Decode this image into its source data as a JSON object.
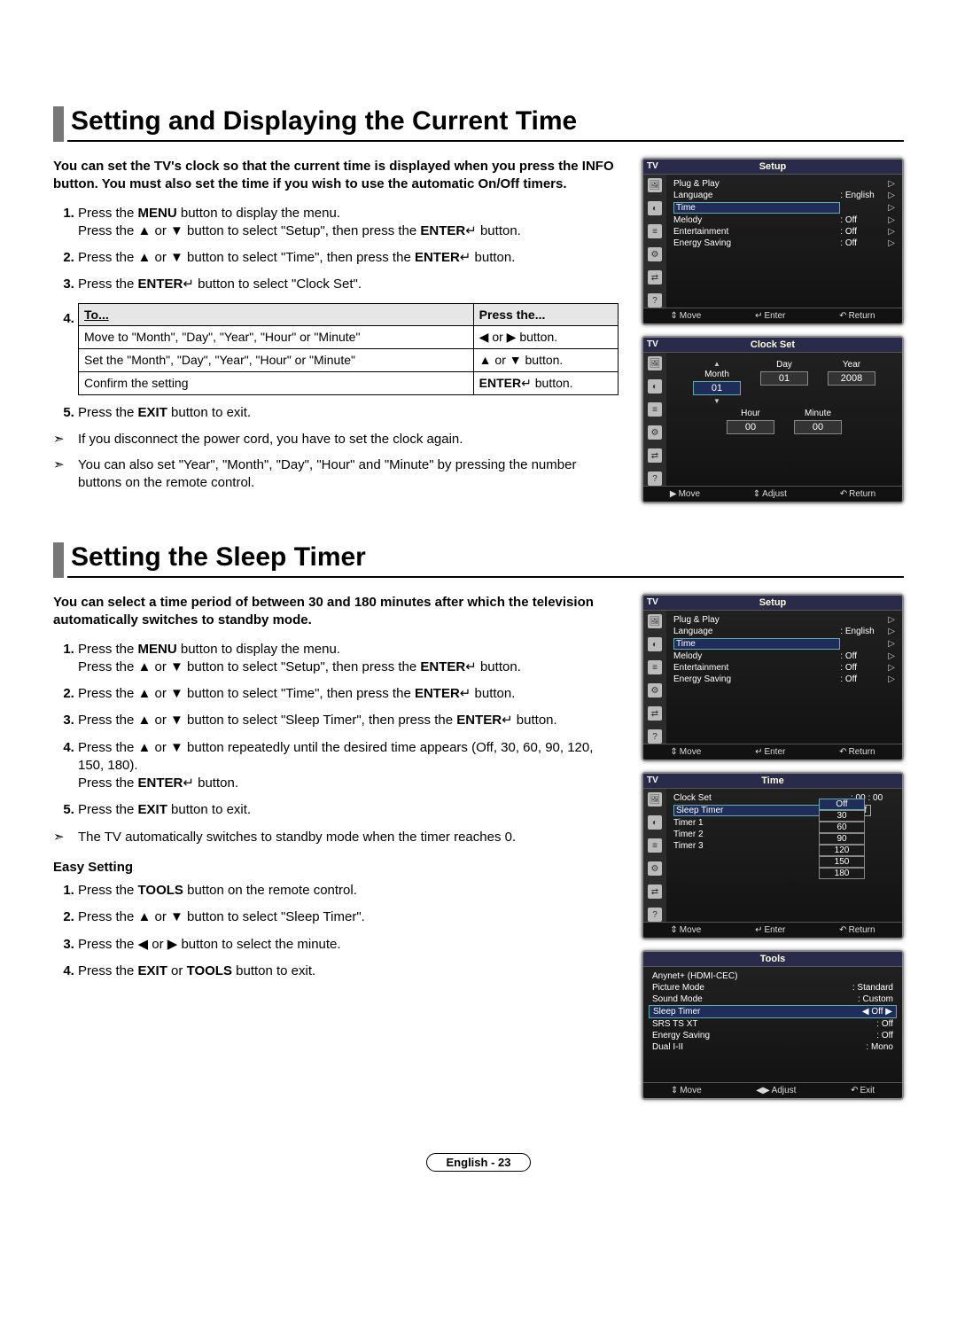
{
  "section1": {
    "heading": "Setting and Displaying the Current Time",
    "intro": "You can set the TV's clock so that the current time is displayed when you press the INFO button. You must also set the time if you wish to use the automatic On/Off timers.",
    "steps": {
      "1": {
        "a": "Press the ",
        "menu": "MENU",
        "b": " button to display the menu.",
        "c": "Press the ▲ or ▼ button to select \"Setup\", then press the ",
        "enter": "ENTER",
        "d": " button."
      },
      "2": {
        "a": "Press the ▲ or ▼ button to select \"Time\", then press the ",
        "enter": "ENTER",
        "b": " button."
      },
      "3": {
        "a": "Press the ",
        "enter": "ENTER",
        "b": " button to select \"Clock Set\"."
      },
      "4num": "4.",
      "5": {
        "a": "Press the ",
        "exit": "EXIT",
        "b": " button to exit."
      }
    },
    "table": {
      "h1": "To...",
      "h2": "Press the...",
      "r1c1": "Move to \"Month\", \"Day\", \"Year\", \"Hour\" or \"Minute\"",
      "r1c2": "◀ or ▶ button.",
      "r2c1": "Set the \"Month\", \"Day\", \"Year\", \"Hour\" or \"Minute\"",
      "r2c2": "▲ or ▼ button.",
      "r3c1": "Confirm the setting",
      "r3c2a": "ENTER",
      "r3c2b": " button."
    },
    "notes": {
      "n1": "If you disconnect the power cord, you have to set the clock again.",
      "n2": "You can also set \"Year\", \"Month\", \"Day\", \"Hour\" and \"Minute\" by pressing the number buttons on the remote control."
    }
  },
  "section2": {
    "heading": "Setting the Sleep Timer",
    "intro": "You can select a time period of between 30 and 180 minutes after which the television automatically switches to standby mode.",
    "steps": {
      "1": {
        "a": "Press the ",
        "menu": "MENU",
        "b": " button to display the menu.",
        "c": "Press the ▲ or ▼ button to select \"Setup\", then press the ",
        "enter": "ENTER",
        "d": " button."
      },
      "2": {
        "a": "Press the ▲ or ▼ button to select \"Time\", then press the ",
        "enter": "ENTER",
        "b": " button."
      },
      "3": {
        "a": "Press the ▲ or ▼ button to select \"Sleep Timer\", then press the ",
        "enter": "ENTER",
        "b": " button."
      },
      "4": {
        "a": "Press the ▲ or ▼ button repeatedly until the desired time appears (Off, 30, 60, 90, 120, 150, 180).",
        "b": "Press the ",
        "enter": "ENTER",
        "c": " button."
      },
      "5": {
        "a": "Press the ",
        "exit": "EXIT",
        "b": " button to exit."
      }
    },
    "note": "The TV automatically switches to standby mode when the timer reaches 0.",
    "easy_heading": "Easy Setting",
    "easy": {
      "1": {
        "a": "Press the ",
        "tools": "TOOLS",
        "b": " button on the remote control."
      },
      "2": "Press the ▲ or ▼ button to select \"Sleep Timer\".",
      "3": "Press the ◀ or ▶ button to select the minute.",
      "4": {
        "a": "Press the ",
        "exit": "EXIT",
        "b": " or ",
        "tools": "TOOLS",
        "c": " button to exit."
      }
    }
  },
  "osd": {
    "tv": "TV",
    "setup": {
      "title": "Setup",
      "items": [
        {
          "label": "Plug & Play",
          "value": "",
          "caret": "▷"
        },
        {
          "label": "Language",
          "value": ": English",
          "caret": "▷"
        },
        {
          "label": "Time",
          "value": "",
          "caret": "▷",
          "hl": true
        },
        {
          "label": "Melody",
          "value": ": Off",
          "caret": "▷"
        },
        {
          "label": "Entertainment",
          "value": ": Off",
          "caret": "▷"
        },
        {
          "label": "Energy Saving",
          "value": ": Off",
          "caret": "▷"
        }
      ],
      "footer": {
        "move": "Move",
        "enter": "Enter",
        "return": "Return"
      }
    },
    "clockset": {
      "title": "Clock Set",
      "row1": [
        {
          "lbl": "Month",
          "val": "01",
          "sel": true
        },
        {
          "lbl": "Day",
          "val": "01"
        },
        {
          "lbl": "Year",
          "val": "2008"
        }
      ],
      "row2": [
        {
          "lbl": "Hour",
          "val": "00"
        },
        {
          "lbl": "Minute",
          "val": "00"
        }
      ],
      "footer": {
        "move": "Move",
        "adjust": "Adjust",
        "return": "Return"
      }
    },
    "time": {
      "title": "Time",
      "items": [
        {
          "label": "Clock Set",
          "value": ": 00 : 00"
        },
        {
          "label": "Sleep Timer",
          "value": "Off",
          "hl": true,
          "boxed": true
        },
        {
          "label": "Timer 1",
          "value": ":"
        },
        {
          "label": "Timer 2",
          "value": ":"
        },
        {
          "label": "Timer 3",
          "value": ":"
        }
      ],
      "dropdown": [
        "Off",
        "30",
        "60",
        "90",
        "120",
        "150",
        "180"
      ],
      "footer": {
        "move": "Move",
        "enter": "Enter",
        "return": "Return"
      }
    },
    "tools": {
      "title": "Tools",
      "items": [
        {
          "label": "Anynet+ (HDMI-CEC)",
          "value": ""
        },
        {
          "label": "Picture Mode",
          "value": ": Standard"
        },
        {
          "label": "Sound Mode",
          "value": ": Custom"
        },
        {
          "label": "Sleep Timer",
          "value": "Off",
          "hl": true
        },
        {
          "label": "SRS TS XT",
          "value": ": Off"
        },
        {
          "label": "Energy Saving",
          "value": ": Off"
        },
        {
          "label": "Dual I-II",
          "value": ": Mono"
        }
      ],
      "footer": {
        "move": "Move",
        "adjust": "Adjust",
        "exit": "Exit"
      }
    }
  },
  "footer": "English - 23"
}
